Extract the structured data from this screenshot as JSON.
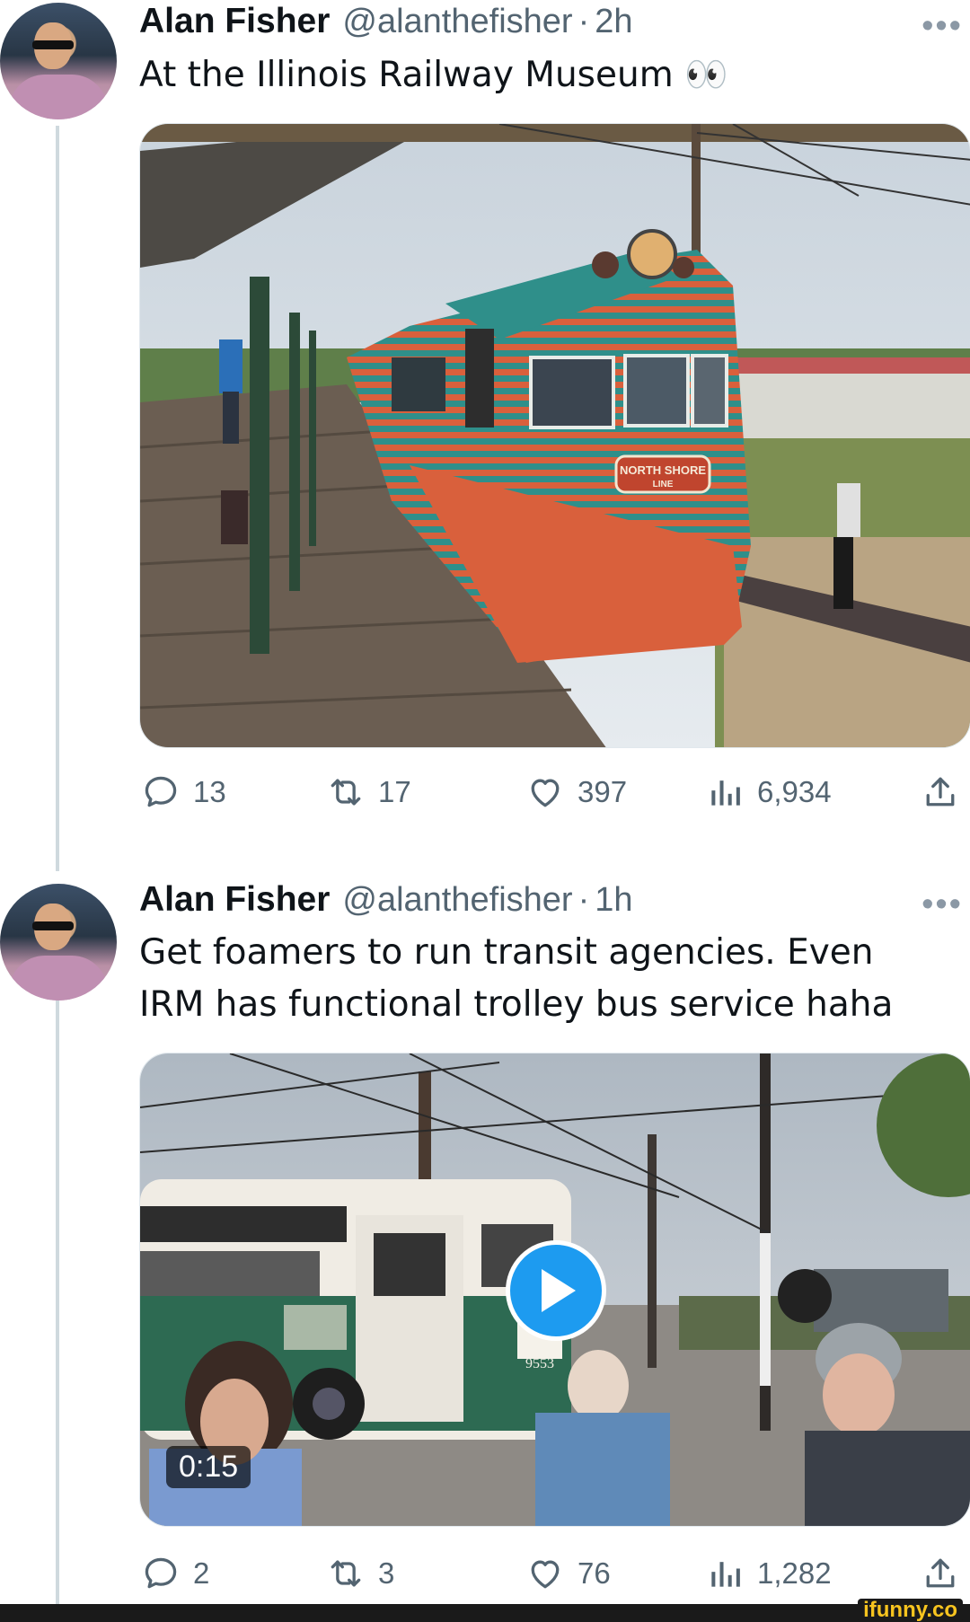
{
  "tweets": [
    {
      "author": "Alan Fisher",
      "handle": "@alanthefisher",
      "separator": "·",
      "time": "2h",
      "text": "At the Illinois Railway Museum 👀",
      "media": {
        "kind": "photo",
        "sign_line1": "NORTH SHORE",
        "sign_line2": "LINE"
      },
      "stats": {
        "replies": "13",
        "reposts": "17",
        "likes": "397",
        "views": "6,934"
      }
    },
    {
      "author": "Alan Fisher",
      "handle": "@alanthefisher",
      "separator": "·",
      "time": "1h",
      "text": "Get foamers to run transit agencies. Even IRM has functional trolley bus service haha",
      "media": {
        "kind": "video",
        "duration": "0:15",
        "bus_number": "9553"
      },
      "stats": {
        "replies": "2",
        "reposts": "3",
        "likes": "76",
        "views": "1,282"
      }
    }
  ],
  "more_label": "•••",
  "watermark": "ifunny.co",
  "colors": {
    "accent": "#1d9bf0",
    "muted": "#536471",
    "text": "#0f1419"
  }
}
